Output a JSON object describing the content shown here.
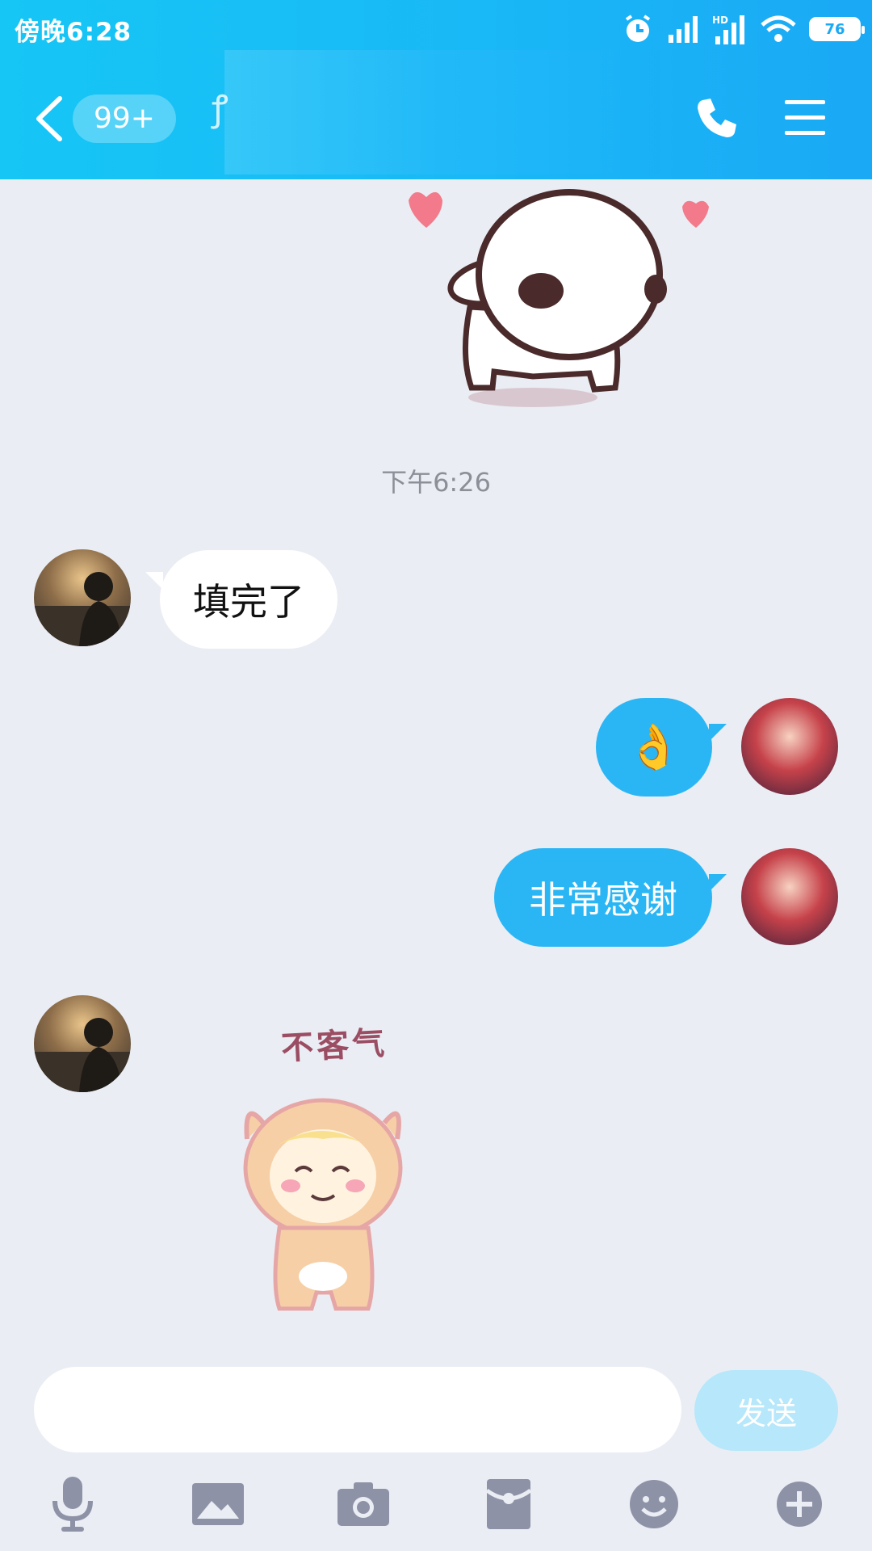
{
  "status_bar": {
    "time": "傍晚6:28",
    "battery": "76"
  },
  "header": {
    "unread_count": "99+",
    "title_partial": "ꝭ"
  },
  "messages": {
    "timestamp": "下午6:26",
    "incoming_1": "填完了",
    "outgoing_emoji": "👌",
    "outgoing_2": "非常感谢",
    "sticker_caption": "不客气"
  },
  "composer": {
    "input_value": "",
    "send_label": "发送"
  },
  "toolbar": {
    "icons": [
      "microphone-icon",
      "image-icon",
      "camera-icon",
      "red-packet-icon",
      "emoji-icon",
      "plus-icon"
    ]
  },
  "colors": {
    "header": "#19B8F6",
    "outgoing_bubble": "#2AB6F5",
    "chat_bg": "#EAEDF4",
    "send_disabled": "#B6E7FA"
  }
}
